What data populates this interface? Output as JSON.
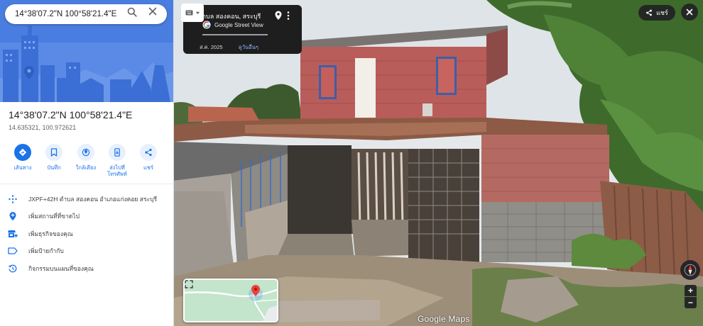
{
  "search": {
    "value": "14°38'07.2\"N 100°58'21.4\"E",
    "search_icon": "search-icon",
    "close_icon": "close-icon"
  },
  "place": {
    "title": "14°38'07.2\"N 100°58'21.4\"E",
    "coords": "14.635321, 100.972621"
  },
  "actions": [
    {
      "label": "เส้นทาง",
      "icon": "directions-icon"
    },
    {
      "label": "บันทึก",
      "icon": "bookmark-icon"
    },
    {
      "label": "ใกล้เคียง",
      "icon": "nearby-icon"
    },
    {
      "label": "ส่งไปที่\nโทรศัพท์",
      "icon": "send-to-phone-icon"
    },
    {
      "label": "แชร์",
      "icon": "share-icon"
    }
  ],
  "info_rows": [
    {
      "text": "JXPF+42H ตำบล สองคอน อำเภอแก่งคอย สระบุรี",
      "icon": "plus-code-icon"
    },
    {
      "text": "เพิ่มสถานที่ที่ขาดไป",
      "icon": "add-place-icon"
    },
    {
      "text": "เพิ่มธุรกิจของคุณ",
      "icon": "add-business-icon"
    },
    {
      "text": "เพิ่มป้ายกำกับ",
      "icon": "label-icon"
    },
    {
      "text": "กิจกรรมบนแผนที่ของคุณ",
      "icon": "history-icon"
    }
  ],
  "street_view": {
    "place_name": "ำบล สองคอน, สระบุรี",
    "logo_text": "Google Street View",
    "date": "ส.ค. 2025",
    "see_more": "ดูวันอื่นๆ",
    "share_label": "แชร์",
    "watermark": "Google Maps",
    "zoom_in": "+",
    "zoom_out": "−"
  },
  "colors": {
    "accent": "#1a73e8",
    "hero_blue": "#4a7de0",
    "card_bg": "#1e1e1e",
    "link_light": "#8ab4f8",
    "pin_red": "#ea4335"
  }
}
